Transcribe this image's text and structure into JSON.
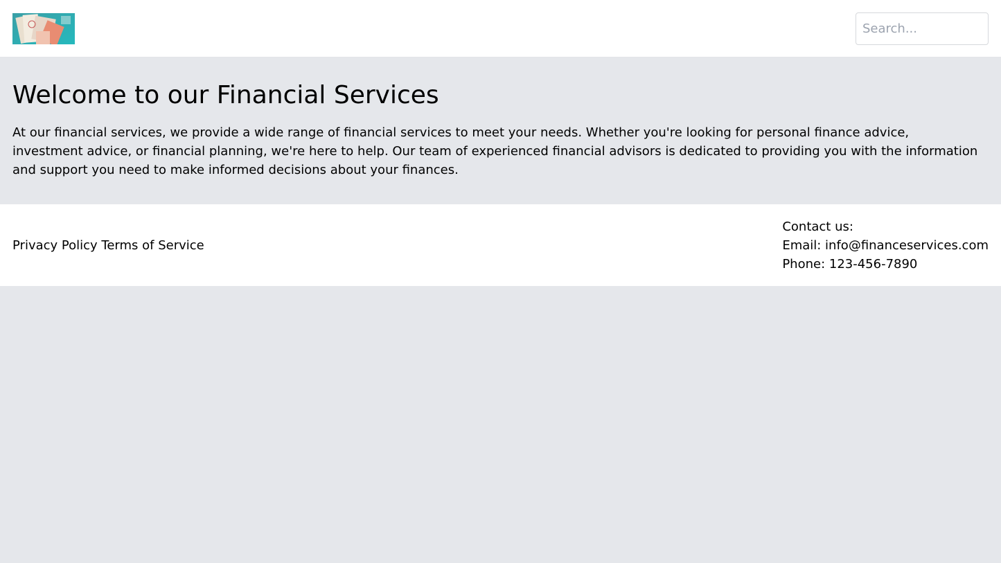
{
  "header": {
    "logo": {
      "name": "logo-image",
      "description_icon": "money-banknotes-image"
    },
    "search": {
      "placeholder": "Search..."
    }
  },
  "hero": {
    "title": "Welcome to our Financial Services",
    "body": "At our financial services, we provide a wide range of financial services to meet your needs. Whether you're looking for personal finance advice, investment advice, or financial planning, we're here to help. Our team of experienced financial advisors is dedicated to providing you with the information and support you need to make informed decisions about your finances."
  },
  "footer": {
    "links": [
      {
        "label": "Privacy Policy"
      },
      {
        "label": "Terms of Service"
      }
    ],
    "contact": {
      "heading": "Contact us:",
      "email": "Email: info@financeservices.com",
      "phone": "Phone: 123-456-7890"
    }
  },
  "colors": {
    "page_background": "#e5e7eb",
    "header_background": "#ffffff",
    "footer_background": "#ffffff",
    "text": "#000000",
    "placeholder": "#9ca3af",
    "input_border": "#d6d8dc"
  }
}
